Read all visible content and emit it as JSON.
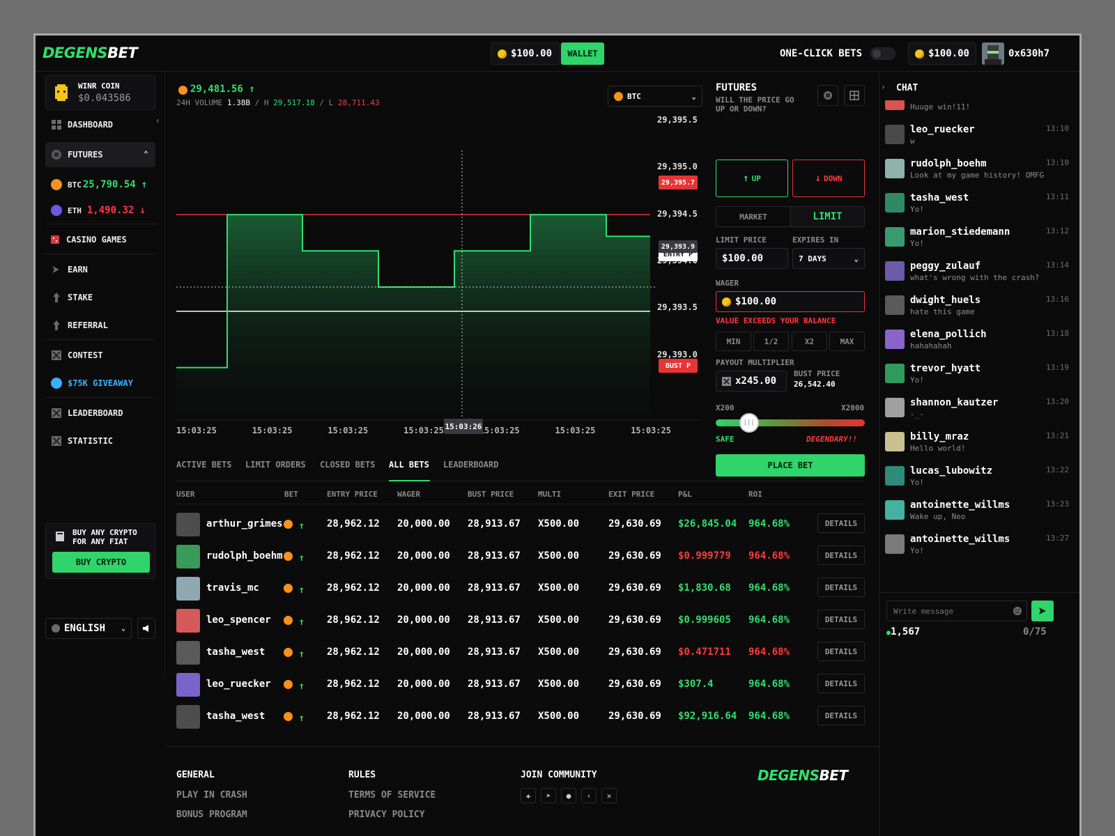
{
  "header": {
    "logo_a": "DEGENS",
    "logo_b": "BET",
    "balance": "$100.00",
    "wallet_label": "WALLET",
    "one_click_label": "ONE-CLICK BETS",
    "balance_right": "$100.00",
    "user": "0x630h7"
  },
  "sidebar": {
    "coin_name": "WINR COIN",
    "coin_price": "$0.043586",
    "dashboard": "DASHBOARD",
    "futures": "FUTURES",
    "btc_label": "BTC",
    "btc_price": "25,790.54",
    "eth_label": "ETH",
    "eth_price": "1,490.32",
    "casino": "CASINO GAMES",
    "earn": "EARN",
    "stake": "STAKE",
    "referral": "REFERRAL",
    "contest": "CONTEST",
    "giveaway": "$75K GIVEAWAY",
    "leaderboard": "LEADERBOARD",
    "statistic": "STATISTIC",
    "buy_promo": "BUY ANY CRYPTO FOR ANY FIAT",
    "buy_button": "BUY CRYPTO",
    "language": "ENGLISH"
  },
  "ticker": {
    "price": "29,481.56",
    "vol_label": "24H VOLUME",
    "vol_value": "1.38B",
    "h_label": "H",
    "h_value": "29,517.18",
    "l_label": "L",
    "l_value": "28,711.43",
    "asset": "BTC"
  },
  "chart_data": {
    "type": "line",
    "y_ticks": [
      "29,395.5",
      "29,395.0",
      "29,394.5",
      "29,394.0",
      "29,393.5",
      "29,393.0"
    ],
    "x_ticks": [
      "15:03:25",
      "15:03:25",
      "15:03:25",
      "15:03:25",
      "15:03:25",
      "15:03:25",
      "15:03:25"
    ],
    "crosshair_time": "15:03:26",
    "crosshair_price": "29,393.9",
    "limit_tag": "29,395.7",
    "entry_tag": "ENTRY P",
    "bust_tag": "BUST P",
    "ylim": [
      29392.7,
      29395.6
    ],
    "limit_line": 29394.95,
    "entry_line": 29393.75,
    "series": [
      {
        "values": [
          29393.05,
          29394.95,
          29394.5,
          29394.05,
          29394.5,
          29394.95,
          29394.68
        ]
      }
    ]
  },
  "panel": {
    "title": "FUTURES",
    "subtitle": "WILL THE PRICE GO UP OR DOWN?",
    "up": "UP",
    "down": "DOWN",
    "market": "MARKET",
    "limit": "LIMIT",
    "limit_price_label": "LIMIT PRICE",
    "limit_price": "$100.00",
    "expires_label": "EXPIRES IN",
    "expires": "7 DAYS",
    "wager_label": "WAGER",
    "wager": "$100.00",
    "error": "VALUE EXCEEDS YOUR BALANCE",
    "min": "MIN",
    "half": "1/2",
    "x2": "X2",
    "max": "MAX",
    "payout_label": "PAYOUT MULTIPLIER",
    "payout": "x245.00",
    "bust_label": "BUST PRICE",
    "bust_value": "26,542.40",
    "slider_min": "X200",
    "slider_max": "X2000",
    "slider_value": 0.12,
    "safe": "SAFE",
    "degen": "DEGENDARY!!",
    "place": "PLACE BET"
  },
  "chat": {
    "title": "CHAT",
    "messages": [
      {
        "name": "",
        "text": "Huuge win!11!",
        "time": "",
        "color": "#d9534f"
      },
      {
        "name": "leo_ruecker",
        "text": "w",
        "time": "13:10",
        "color": "#4a4a4a"
      },
      {
        "name": "rudolph_boehm",
        "text": "Look at my game history! OMFG",
        "time": "13:10",
        "color": "#8fb3a8"
      },
      {
        "name": "tasha_west",
        "text": "Yo!",
        "time": "13:11",
        "color": "#2e8a63"
      },
      {
        "name": "marion_stiedemann",
        "text": "Yo!",
        "time": "13:12",
        "color": "#3a9a70"
      },
      {
        "name": "peggy_zulauf",
        "text": "what's wrong with the crash?",
        "time": "13:14",
        "color": "#6d5aa8"
      },
      {
        "name": "dwight_huels",
        "text": "hate this game",
        "time": "13:16",
        "color": "#5a5a5a"
      },
      {
        "name": "elena_pollich",
        "text": "hahahahah",
        "time": "13:18",
        "color": "#8a64c9"
      },
      {
        "name": "trevor_hyatt",
        "text": "Yo!",
        "time": "13:19",
        "color": "#2f9a5a"
      },
      {
        "name": "shannon_kautzer",
        "text": "-_-",
        "time": "13:20",
        "color": "#a0a0a0"
      },
      {
        "name": "billy_mraz",
        "text": "Hello world!",
        "time": "13:21",
        "color": "#c9c28f"
      },
      {
        "name": "lucas_lubowitz",
        "text": "Yo!",
        "time": "13:22",
        "color": "#2e8a7a"
      },
      {
        "name": "antoinette_willms",
        "text": "Wake up, Neo",
        "time": "13:23",
        "color": "#43b2a0"
      },
      {
        "name": "antoinette_willms",
        "text": "Yo!",
        "time": "13:27",
        "color": "#7a7a7a"
      }
    ],
    "placeholder": "Write message",
    "online": "1,567",
    "counter": "0/75"
  },
  "tabs": {
    "active": "ACTIVE BETS",
    "limit": "LIMIT ORDERS",
    "closed": "CLOSED BETS",
    "all": "ALL BETS",
    "leaderboard": "LEADERBOARD"
  },
  "table": {
    "headers": [
      "USER",
      "BET",
      "ENTRY PRICE",
      "WAGER",
      "BUST PRICE",
      "MULTI",
      "EXIT PRICE",
      "P&L",
      "ROI"
    ],
    "details": "DETAILS",
    "rows": [
      {
        "user": "arthur_grimes",
        "entry": "28,962.12",
        "wager": "20,000.00",
        "bust": "28,913.67",
        "multi": "X500.00",
        "exit": "29,630.69",
        "pnl": "$26,845.04",
        "pnl_pos": true,
        "roi": "964.68%",
        "roi_pos": true,
        "color": "#4d4d4d"
      },
      {
        "user": "rudolph_boehm",
        "entry": "28,962.12",
        "wager": "20,000.00",
        "bust": "28,913.67",
        "multi": "X500.00",
        "exit": "29,630.69",
        "pnl": "$0.999779",
        "pnl_pos": false,
        "roi": "964.68%",
        "roi_pos": false,
        "color": "#3a9a5a"
      },
      {
        "user": "travis_mc",
        "entry": "28,962.12",
        "wager": "20,000.00",
        "bust": "28,913.67",
        "multi": "X500.00",
        "exit": "29,630.69",
        "pnl": "$1,830.68",
        "pnl_pos": true,
        "roi": "964.68%",
        "roi_pos": true,
        "color": "#8fa9b3"
      },
      {
        "user": "leo_spencer",
        "entry": "28,962.12",
        "wager": "20,000.00",
        "bust": "28,913.67",
        "multi": "X500.00",
        "exit": "29,630.69",
        "pnl": "$0.999605",
        "pnl_pos": true,
        "roi": "964.68%",
        "roi_pos": true,
        "color": "#d45a5a"
      },
      {
        "user": "tasha_west",
        "entry": "28,962.12",
        "wager": "20,000.00",
        "bust": "28,913.67",
        "multi": "X500.00",
        "exit": "29,630.69",
        "pnl": "$0.471711",
        "pnl_pos": false,
        "roi": "964.68%",
        "roi_pos": false,
        "color": "#5a5a5a"
      },
      {
        "user": "leo_ruecker",
        "entry": "28,962.12",
        "wager": "20,000.00",
        "bust": "28,913.67",
        "multi": "X500.00",
        "exit": "29,630.69",
        "pnl": "$307.4",
        "pnl_pos": true,
        "roi": "964.68%",
        "roi_pos": true,
        "color": "#7a64c9"
      },
      {
        "user": "tasha_west",
        "entry": "28,962.12",
        "wager": "20,000.00",
        "bust": "28,913.67",
        "multi": "X500.00",
        "exit": "29,630.69",
        "pnl": "$92,916.64",
        "pnl_pos": true,
        "roi": "964.68%",
        "roi_pos": true,
        "color": "#4d4d4d"
      }
    ]
  },
  "footer": {
    "general": "GENERAL",
    "play": "PLAY IN CRASH",
    "bonus": "BONUS PROGRAM",
    "rules": "RULES",
    "terms": "TERMS OF SERVICE",
    "privacy": "PRIVACY POLICY",
    "community": "JOIN COMMUNITY",
    "logo_a": "DEGENS",
    "logo_b": "BET"
  },
  "colors": {
    "accent": "#2fe06b",
    "danger": "#ff3b3b",
    "bg": "#0b0b0c"
  }
}
